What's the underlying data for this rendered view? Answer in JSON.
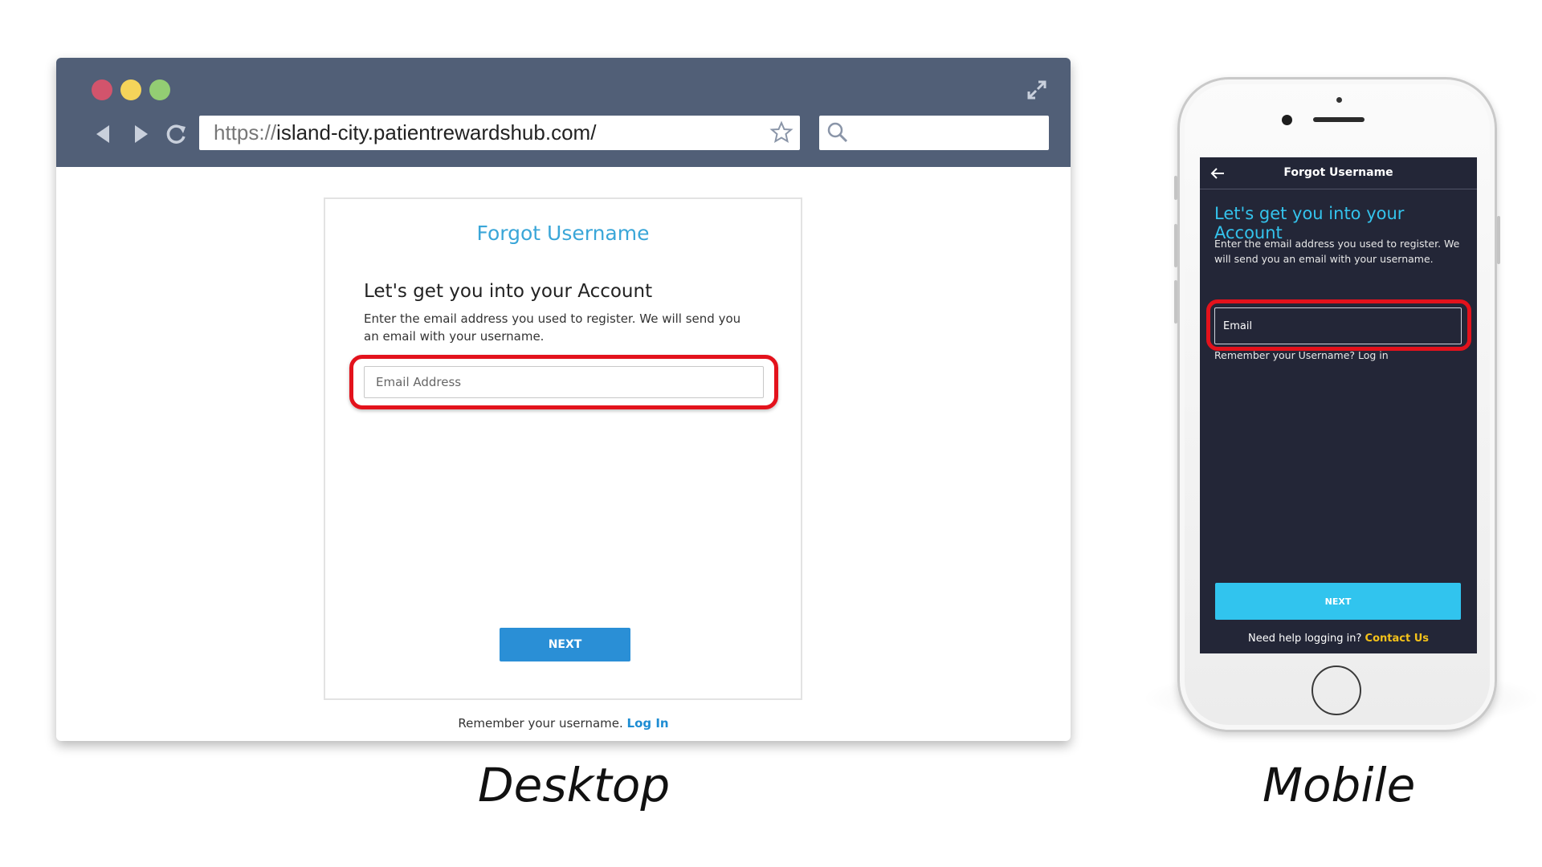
{
  "desktop": {
    "url_protocol": "https://",
    "url_host": "island-city.patientrewardshub.com/",
    "card_title": "Forgot Username",
    "heading": "Let's get you into your Account",
    "description": "Enter the email address you used to register. We will send you an email with your username.",
    "email_placeholder": "Email Address",
    "next_label": "NEXT",
    "remember_text": "Remember your username.",
    "login_link": "Log In",
    "caption": "Desktop",
    "colors": {
      "chrome": "#515f77",
      "title": "#3aa6d8",
      "next": "#2a8fd6",
      "highlight": "#e3121c"
    },
    "icons": [
      "close-dot",
      "minimize-dot",
      "maximize-dot",
      "expand-icon",
      "back-arrow-icon",
      "forward-arrow-icon",
      "reload-icon",
      "star-icon",
      "search-icon"
    ]
  },
  "mobile": {
    "header_title": "Forgot Username",
    "heading": "Let's get you into your Account",
    "description": "Enter the email address you used to register. We will send you an email with your username.",
    "email_placeholder": "Email",
    "remember_text": "Remember your Username? Log in",
    "next_label": "NEXT",
    "help_text": "Need help logging in?",
    "contact_link": "Contact Us",
    "caption": "Mobile",
    "colors": {
      "screen": "#232637",
      "heading": "#34c3ec",
      "next": "#31c4ee",
      "contact": "#f4c21a",
      "highlight": "#e3121c"
    },
    "icons": [
      "back-arrow-icon"
    ]
  }
}
